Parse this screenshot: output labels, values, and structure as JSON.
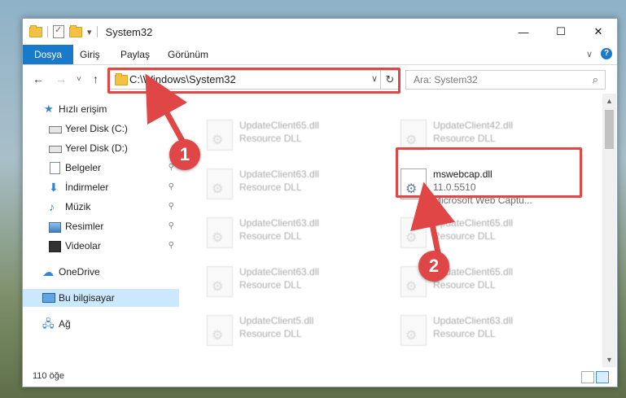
{
  "window": {
    "title": "System32",
    "controls": {
      "minimize": "—",
      "maximize": "☐",
      "close": "✕"
    }
  },
  "ribbon": {
    "tabs": [
      "Dosya",
      "Giriş",
      "Paylaş",
      "Görünüm"
    ],
    "collapse_icon": "chevron-down-icon",
    "help_icon": "help-icon",
    "help_glyph": "?"
  },
  "nav": {
    "back": "←",
    "forward": "→",
    "recent": "˅",
    "up": "↑",
    "address": "C:\\Windows\\System32",
    "address_dropdown": "∨",
    "refresh": "↻",
    "search_placeholder": "Ara: System32",
    "search_glyph": "⌕"
  },
  "sidebar": {
    "items": [
      {
        "label": "Hızlı erişim",
        "icon": "star-icon",
        "pinned": false
      },
      {
        "label": "Yerel Disk (C:)",
        "icon": "drive-icon",
        "pinned": false
      },
      {
        "label": "Yerel Disk (D:)",
        "icon": "drive-icon",
        "pinned": false
      },
      {
        "label": "Belgeler",
        "icon": "documents-icon",
        "pinned": true
      },
      {
        "label": "İndirmeler",
        "icon": "download-icon",
        "pinned": true
      },
      {
        "label": "Müzik",
        "icon": "music-icon",
        "pinned": true
      },
      {
        "label": "Resimler",
        "icon": "pictures-icon",
        "pinned": true
      },
      {
        "label": "Videolar",
        "icon": "videos-icon",
        "pinned": true
      },
      {
        "label": "OneDrive",
        "icon": "cloud-icon",
        "pinned": false
      },
      {
        "label": "Bu bilgisayar",
        "icon": "computer-icon",
        "pinned": false,
        "selected": true
      },
      {
        "label": "Ağ",
        "icon": "network-icon",
        "pinned": false
      }
    ],
    "pin_glyph": "📌"
  },
  "files": [
    {
      "name": "UpdateClient65.dll",
      "type": "Resource DLL"
    },
    {
      "name": "UpdateClient42.dll",
      "type": "Resource DLL"
    },
    {
      "name": "UpdateClient63.dll",
      "type": "Resource DLL"
    },
    {
      "name": "mswebcap.dll",
      "version": "11.0.5510",
      "description": "Microsoft Web Captu...",
      "focused": true
    },
    {
      "name": "UpdateClient63.dll",
      "type": "Resource DLL"
    },
    {
      "name": "UpdateClient65.dll",
      "type": "Resource DLL"
    },
    {
      "name": "UpdateClient63.dll",
      "type": "Resource DLL"
    },
    {
      "name": "UpdateClient65.dll",
      "type": "Resource DLL"
    },
    {
      "name": "UpdateClient5.dll",
      "type": "Resource DLL"
    },
    {
      "name": "UpdateClient63.dll",
      "type": "Resource DLL"
    }
  ],
  "status": {
    "count": "110 öğe"
  },
  "annotations": {
    "step1": "1",
    "step2": "2",
    "color": "#e04646"
  }
}
